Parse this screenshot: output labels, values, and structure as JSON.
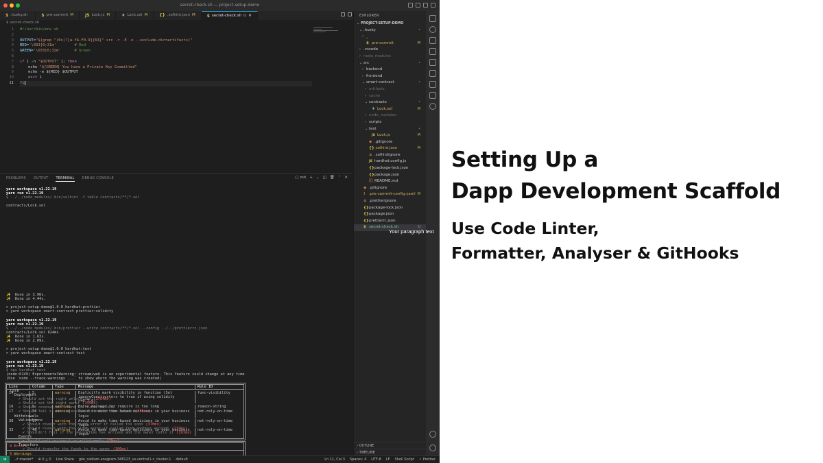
{
  "window": {
    "title": "secret-check.sh — project-setup-demo"
  },
  "tabs": [
    {
      "icon": "$",
      "icon_color": "#d7b55b",
      "label": ".husky.sh",
      "status": ""
    },
    {
      "icon": "$",
      "icon_color": "#d7b55b",
      "label": "pre-commit",
      "status": "M"
    },
    {
      "icon": "JS",
      "icon_color": "#d7c84a",
      "label": "Lock.js",
      "status": "M"
    },
    {
      "icon": "♦",
      "icon_color": "#8aa6c8",
      "label": "Lock.sol",
      "status": "M"
    },
    {
      "icon": "{}",
      "icon_color": "#d7c84a",
      "label": ".solhint.json",
      "status": "M"
    },
    {
      "icon": "$",
      "icon_color": "#d7b55b",
      "label": "secret-check.sh",
      "status": "U",
      "active": true,
      "close": "✕"
    }
  ],
  "breadcrumb": "$ secret-check.sh",
  "editor": {
    "line_numbers": [
      "1",
      "2",
      "3",
      "4",
      "5",
      "6",
      "7",
      "8",
      "9",
      "10",
      "11"
    ],
    "lines": {
      "l1": "#!/usr/bin/env sh",
      "l3a": "OUTPUT=",
      "l3b": "\"$(grep \"(0x)?[a-fA-F0-9]{64}\" src -r -E -o --exclude-dir=artifacts)\"",
      "l4a": "RED=",
      "l4b": "'\\033[0;31m'",
      "l4c": "# Red",
      "l5a": "GREEN=",
      "l5b": "'\\033[0;32m'",
      "l5c": "# Green",
      "l7a": "if",
      "l7b": " [ -n ",
      "l7c": "\"$OUTPUT\"",
      "l7d": " ]; ",
      "l7e": "then",
      "l8a": "echo ",
      "l8b": "\"${GREEN} You have a Private Key Committed\"",
      "l9": "echo -e ${RED} $OUTPUT",
      "l10a": "exit ",
      "l10b": "1",
      "l11": "fi"
    }
  },
  "panel": {
    "tabs": [
      "PROBLEMS",
      "OUTPUT",
      "TERMINAL",
      "DEBUG CONSOLE"
    ],
    "shell": "zsh"
  },
  "terminal": {
    "block1": [
      "yarn workspace v1.22.19",
      "yarn run v1.22.19"
    ],
    "cmd1": "$ ../../node_modules/.bin/solhint -f table contracts/**/*.sol",
    "file1": "contracts/Lock.sol",
    "table": {
      "headers": [
        "Line",
        "Column",
        "Type",
        "Message",
        "Rule ID"
      ],
      "rows": [
        {
          "line": "14",
          "col": "5",
          "type": "warning",
          "msg": "Explicitly mark visibility in function (Set ignoreConstructors to true if using solidity >=0.7.0)",
          "rule": "func-visibility"
        },
        {
          "line": "16",
          "col": "9",
          "type": "warning",
          "msg": "Error message for require is too long",
          "rule": "reason-string"
        },
        {
          "line": "17",
          "col": "13",
          "type": "warning",
          "msg": "Avoid to make time-based decisions in your business logic",
          "rule": "not-rely-on-time"
        },
        {
          "line": "30",
          "col": "17",
          "type": "warning",
          "msg": "Avoid to make time-based decisions in your business logic",
          "rule": "not-rely-on-time"
        },
        {
          "line": "33",
          "col": "48",
          "type": "warning",
          "msg": "Avoid to make time-based decisions in your business logic",
          "rule": "not-rely-on-time"
        }
      ],
      "errors": "0 Errors",
      "warnings": "5 Warnings"
    },
    "done1": "✨  Done in 3.90s.",
    "done2": "✨  Done in 4.44s.",
    "p1": "> project-setup-demo@1.0.0 hardhat:prettier",
    "p2": "> yarn workspace smart-contract prettier:solidity",
    "block2": [
      "yarn workspace v1.22.19",
      "yarn run v1.22.19"
    ],
    "cmd2": "$ ../../node_modules/.bin/prettier --write contracts/**/*.sol --config ../../prettierrc.json",
    "file2": "contracts/Lock.sol 624ms",
    "done3": "✨  Done in 1.63s.",
    "done4": "✨  Done in 2.09s.",
    "p3": "> project-setup-demo@1.0.0 hardhat:test",
    "p4": "> yarn workspace smart-contract test",
    "block3": [
      "yarn workspace v1.22.19",
      "yarn run v1.22.19"
    ],
    "cmd3": "$ npx hardhat test",
    "warn1": "(node:6149) ExperimentalWarning: stream/web is an experimental feature. This feature could change at any time",
    "warn2": "(Use `node --trace-warnings ...` to show where the warning was created)",
    "tests": [
      {
        "indent": 1,
        "text": "Lock",
        "time": ""
      },
      {
        "indent": 2,
        "text": "Deployment",
        "time": ""
      },
      {
        "indent": 3,
        "text": "✔ Should set the right unlockTime",
        "time": "(3764ms)"
      },
      {
        "indent": 3,
        "text": "✔ Should set the right owner",
        "time": "(145ms)"
      },
      {
        "indent": 3,
        "text": "✔ Should receive and store the funds to lock",
        "time": ""
      },
      {
        "indent": 3,
        "text": "✔ Should fail if the unlockTime is not in the future",
        "time": "(226ms)"
      },
      {
        "indent": 2,
        "text": "Withdrawals",
        "time": ""
      },
      {
        "indent": 3,
        "text": "Validations",
        "time": ""
      },
      {
        "indent": 4,
        "text": "✔ Should revert with the right error if called too soon",
        "time": "(370ms)"
      },
      {
        "indent": 4,
        "text": "✔ Should revert with the right error if called from another account",
        "time": "(219ms)"
      },
      {
        "indent": 4,
        "text": "✔ Shouldn't fail if the unlockTime has arrived and the owner calls it",
        "time": "(191ms)"
      },
      {
        "indent": 3,
        "text": "Events",
        "time": ""
      },
      {
        "indent": 4,
        "text": "✔ Should emit an event on withdrawals",
        "time": "(59ms)"
      },
      {
        "indent": 3,
        "text": "Transfers",
        "time": ""
      },
      {
        "indent": 4,
        "text": "✔ Should transfer the funds to the owner",
        "time": "(106ms)"
      }
    ]
  },
  "explorer": {
    "header": "EXPLORER",
    "items": [
      {
        "depth": 0,
        "arrow": "⌄",
        "icon": "",
        "label": "PROJECT-SETUP-DEMO",
        "status": "",
        "color": "#cccccc",
        "bold": true
      },
      {
        "depth": 1,
        "arrow": "⌄",
        "icon": "",
        "label": ".husky",
        "status": "•",
        "color": "#cccccc"
      },
      {
        "depth": 2,
        "arrow": "›",
        "icon": "",
        "label": "_",
        "status": "",
        "color": "#cccccc"
      },
      {
        "depth": 2,
        "arrow": "",
        "icon": "$",
        "label": "pre-commit",
        "status": "M",
        "color": "#d7b55b"
      },
      {
        "depth": 1,
        "arrow": "›",
        "icon": "",
        "label": ".vscode",
        "status": "",
        "color": "#cccccc"
      },
      {
        "depth": 1,
        "arrow": "›",
        "icon": "",
        "label": "node_modules",
        "status": "",
        "color": "#6e6e6e"
      },
      {
        "depth": 1,
        "arrow": "⌄",
        "icon": "",
        "label": "src",
        "status": "•",
        "color": "#cccccc"
      },
      {
        "depth": 2,
        "arrow": "›",
        "icon": "",
        "label": "backend",
        "status": "",
        "color": "#cccccc"
      },
      {
        "depth": 2,
        "arrow": "›",
        "icon": "",
        "label": "frontend",
        "status": "",
        "color": "#cccccc"
      },
      {
        "depth": 2,
        "arrow": "⌄",
        "icon": "",
        "label": "smart-contract",
        "status": "•",
        "color": "#cccccc"
      },
      {
        "depth": 3,
        "arrow": "›",
        "icon": "",
        "label": "artifacts",
        "status": "",
        "color": "#6e6e6e"
      },
      {
        "depth": 3,
        "arrow": "›",
        "icon": "",
        "label": "cache",
        "status": "",
        "color": "#6e6e6e"
      },
      {
        "depth": 3,
        "arrow": "⌄",
        "icon": "",
        "label": "contracts",
        "status": "•",
        "color": "#cccccc"
      },
      {
        "depth": 4,
        "arrow": "",
        "icon": "♦",
        "label": "Lock.sol",
        "status": "M",
        "color": "#d7b55b"
      },
      {
        "depth": 3,
        "arrow": "›",
        "icon": "",
        "label": "node_modules",
        "status": "",
        "color": "#6e6e6e"
      },
      {
        "depth": 3,
        "arrow": "›",
        "icon": "",
        "label": "scripts",
        "status": "",
        "color": "#cccccc"
      },
      {
        "depth": 3,
        "arrow": "⌄",
        "icon": "",
        "label": "test",
        "status": "•",
        "color": "#cccccc"
      },
      {
        "depth": 4,
        "arrow": "",
        "icon": "JS",
        "label": "Lock.js",
        "status": "M",
        "color": "#d7b55b"
      },
      {
        "depth": 3,
        "arrow": "",
        "icon": "◆",
        "label": ".gitignore",
        "status": "",
        "color": "#cccccc"
      },
      {
        "depth": 3,
        "arrow": "",
        "icon": "{}",
        "label": ".solhint.json",
        "status": "M",
        "color": "#d7b55b"
      },
      {
        "depth": 3,
        "arrow": "",
        "icon": "≡",
        "label": ".solhintignore",
        "status": "",
        "color": "#cccccc"
      },
      {
        "depth": 3,
        "arrow": "",
        "icon": "JS",
        "label": "hardhat.config.js",
        "status": "",
        "color": "#cccccc"
      },
      {
        "depth": 3,
        "arrow": "",
        "icon": "{}",
        "label": "package-lock.json",
        "status": "",
        "color": "#cccccc"
      },
      {
        "depth": 3,
        "arrow": "",
        "icon": "{}",
        "label": "package.json",
        "status": "",
        "color": "#cccccc"
      },
      {
        "depth": 3,
        "arrow": "",
        "icon": "ⓘ",
        "label": "README.md",
        "status": "",
        "color": "#cccccc"
      },
      {
        "depth": 1,
        "arrow": "",
        "icon": "◆",
        "label": ".gitignore",
        "status": "",
        "color": "#cccccc"
      },
      {
        "depth": 1,
        "arrow": "",
        "icon": "!",
        "label": ".pre-commit-config.yaml",
        "status": "M",
        "color": "#d7b55b"
      },
      {
        "depth": 1,
        "arrow": "",
        "icon": "≡",
        "label": ".prettierignore",
        "status": "",
        "color": "#cccccc"
      },
      {
        "depth": 1,
        "arrow": "",
        "icon": "{}",
        "label": "package-lock.json",
        "status": "",
        "color": "#cccccc"
      },
      {
        "depth": 1,
        "arrow": "",
        "icon": "{}",
        "label": "package.json",
        "status": "",
        "color": "#cccccc"
      },
      {
        "depth": 1,
        "arrow": "",
        "icon": "{}",
        "label": "prettierrc.json",
        "status": "",
        "color": "#cccccc"
      },
      {
        "depth": 1,
        "arrow": "",
        "icon": "$",
        "label": "secret-check.sh",
        "status": "U",
        "color": "#73c991",
        "selected": true
      }
    ],
    "outline": "OUTLINE",
    "timeline": "TIMELINE"
  },
  "statusbar": {
    "remote": "⋊",
    "branch": "⎇ master*",
    "sync": "⊗ 0 ⚠ 0",
    "errors": "⊗ 0 △ 0",
    "liveshare": "Live Share",
    "cluster": "gke_cadium-anagram-348123_us-central1-c_cluster-1",
    "ns": "default",
    "pos": "Ln 11, Col 3",
    "spaces": "Spaces: 4",
    "enc": "UTF-8",
    "eol": "LF",
    "lang": "Shell Script",
    "prettier": "✓ Prettier"
  },
  "tooltip": "Your paragraph text",
  "headline": {
    "line1": "Setting Up a",
    "line2": "Dapp Development Scaffold"
  },
  "subheadline": {
    "line1": "Use Code Linter,",
    "line2": "Formatter, Analyser & GitHooks"
  }
}
